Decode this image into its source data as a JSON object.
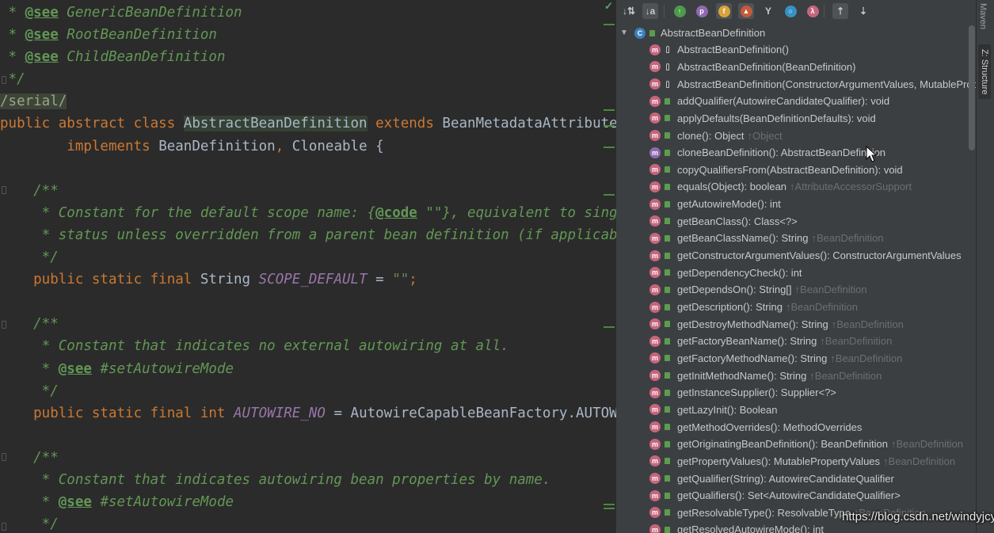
{
  "editor": {
    "lines": [
      [
        {
          "t": " * ",
          "c": "doc"
        },
        {
          "t": "@see",
          "c": "doctag"
        },
        {
          "t": " GenericBeanDefinition",
          "c": "doc"
        }
      ],
      [
        {
          "t": " * ",
          "c": "doc"
        },
        {
          "t": "@see",
          "c": "doctag"
        },
        {
          "t": " RootBeanDefinition",
          "c": "doc"
        }
      ],
      [
        {
          "t": " * ",
          "c": "doc"
        },
        {
          "t": "@see",
          "c": "doctag"
        },
        {
          "t": " ChildBeanDefinition",
          "c": "doc"
        }
      ],
      [
        {
          "t": " */",
          "c": "doc"
        }
      ],
      [
        {
          "t": "/serial/",
          "c": "serial"
        }
      ],
      [
        {
          "t": "public abstract class ",
          "c": "kw"
        },
        {
          "t": "AbstractBeanDefinition",
          "c": "hl"
        },
        {
          "t": " extends ",
          "c": "kw"
        },
        {
          "t": "BeanMetadataAttributeAccessor",
          "c": "plain"
        }
      ],
      [
        {
          "t": "        implements ",
          "c": "kw"
        },
        {
          "t": "BeanDefinition",
          "c": "plain"
        },
        {
          "t": ", ",
          "c": "kw"
        },
        {
          "t": "Cloneable {",
          "c": "plain"
        }
      ],
      [],
      [
        {
          "t": "    /**",
          "c": "doc"
        }
      ],
      [
        {
          "t": "     * Constant for the default scope name: ",
          "c": "doc"
        },
        {
          "t": "{",
          "c": "doc"
        },
        {
          "t": "@code",
          "c": "doctag"
        },
        {
          "t": " \"\"}, equivalent to singleton",
          "c": "doc"
        }
      ],
      [
        {
          "t": "     * status unless overridden from a parent bean definition (if applicable).",
          "c": "doc"
        }
      ],
      [
        {
          "t": "     */",
          "c": "doc"
        }
      ],
      [
        {
          "t": "    public static final ",
          "c": "kw"
        },
        {
          "t": "String ",
          "c": "plain"
        },
        {
          "t": "SCOPE_DEFAULT",
          "c": "const"
        },
        {
          "t": " = ",
          "c": "plain"
        },
        {
          "t": "\"\"",
          "c": "str"
        },
        {
          "t": ";",
          "c": "kw"
        }
      ],
      [],
      [
        {
          "t": "    /**",
          "c": "doc"
        }
      ],
      [
        {
          "t": "     * Constant that indicates no external autowiring at all.",
          "c": "doc"
        }
      ],
      [
        {
          "t": "     * ",
          "c": "doc"
        },
        {
          "t": "@see",
          "c": "doctag"
        },
        {
          "t": " #setAutowireMode",
          "c": "doc"
        }
      ],
      [
        {
          "t": "     */",
          "c": "doc"
        }
      ],
      [
        {
          "t": "    public static final int ",
          "c": "kw"
        },
        {
          "t": "AUTOWIRE_NO",
          "c": "const"
        },
        {
          "t": " = AutowireCapableBeanFactory.AUTOWIRE_NO;",
          "c": "plain"
        }
      ],
      [],
      [
        {
          "t": "    /**",
          "c": "doc"
        }
      ],
      [
        {
          "t": "     * Constant that indicates autowiring bean properties by name.",
          "c": "doc"
        }
      ],
      [
        {
          "t": "     * ",
          "c": "doc"
        },
        {
          "t": "@see",
          "c": "doctag"
        },
        {
          "t": " #setAutowireMode",
          "c": "doc"
        }
      ],
      [
        {
          "t": "     */",
          "c": "doc"
        }
      ]
    ]
  },
  "structure": {
    "toolbar": [
      {
        "icon": "sort-by-visibility-icon",
        "glyph": "↓⇅"
      },
      {
        "icon": "sort-alphabetically-icon",
        "glyph": "↓a"
      },
      {
        "icon": "show-inherited-icon",
        "glyph": "↑",
        "color": "#4e9a4b"
      },
      {
        "icon": "show-properties-icon",
        "glyph": "p",
        "color": "#8f6ab0"
      },
      {
        "icon": "show-fields-icon",
        "glyph": "f",
        "color": "#d9a33a"
      },
      {
        "icon": "show-non-public-icon",
        "glyph": "▲",
        "color": "#c45a3c"
      },
      {
        "icon": "show-lambdas-icon",
        "glyph": "Y"
      },
      {
        "icon": "show-anonymous-icon",
        "glyph": "○",
        "color": "#3592c4"
      },
      {
        "icon": "show-lambda-icon",
        "glyph": "λ",
        "color": "#c6657d"
      },
      {
        "icon": "autoscroll-to-source-icon",
        "glyph": "⇡"
      },
      {
        "icon": "autoscroll-from-source-icon",
        "glyph": "⇣"
      }
    ],
    "root": "AbstractBeanDefinition",
    "members": [
      {
        "name": "AbstractBeanDefinition()",
        "vis": "protected"
      },
      {
        "name": "AbstractBeanDefinition(BeanDefinition)",
        "vis": "protected"
      },
      {
        "name": "AbstractBeanDefinition(ConstructorArgumentValues, MutablePropertyValues)",
        "vis": "protected"
      },
      {
        "name": "addQualifier(AutowireCandidateQualifier): void",
        "vis": "public"
      },
      {
        "name": "applyDefaults(BeanDefinitionDefaults): void",
        "vis": "public"
      },
      {
        "name": "clone(): Object",
        "inh": "↑Object",
        "vis": "public"
      },
      {
        "name": "cloneBeanDefinition(): AbstractBeanDefinition",
        "vis": "public",
        "override": true
      },
      {
        "name": "copyQualifiersFrom(AbstractBeanDefinition): void",
        "vis": "public"
      },
      {
        "name": "equals(Object): boolean",
        "inh": "↑AttributeAccessorSupport",
        "vis": "public"
      },
      {
        "name": "getAutowireMode(): int",
        "vis": "public"
      },
      {
        "name": "getBeanClass(): Class<?>",
        "vis": "public"
      },
      {
        "name": "getBeanClassName(): String",
        "inh": "↑BeanDefinition",
        "vis": "public"
      },
      {
        "name": "getConstructorArgumentValues(): ConstructorArgumentValues",
        "vis": "public"
      },
      {
        "name": "getDependencyCheck(): int",
        "vis": "public"
      },
      {
        "name": "getDependsOn(): String[]",
        "inh": "↑BeanDefinition",
        "vis": "public"
      },
      {
        "name": "getDescription(): String",
        "inh": "↑BeanDefinition",
        "vis": "public"
      },
      {
        "name": "getDestroyMethodName(): String",
        "inh": "↑BeanDefinition",
        "vis": "public"
      },
      {
        "name": "getFactoryBeanName(): String",
        "inh": "↑BeanDefinition",
        "vis": "public"
      },
      {
        "name": "getFactoryMethodName(): String",
        "inh": "↑BeanDefinition",
        "vis": "public"
      },
      {
        "name": "getInitMethodName(): String",
        "inh": "↑BeanDefinition",
        "vis": "public"
      },
      {
        "name": "getInstanceSupplier(): Supplier<?>",
        "vis": "public"
      },
      {
        "name": "getLazyInit(): Boolean",
        "vis": "public"
      },
      {
        "name": "getMethodOverrides(): MethodOverrides",
        "vis": "public"
      },
      {
        "name": "getOriginatingBeanDefinition(): BeanDefinition",
        "inh": "↑BeanDefinition",
        "vis": "public"
      },
      {
        "name": "getPropertyValues(): MutablePropertyValues",
        "inh": "↑BeanDefinition",
        "vis": "public"
      },
      {
        "name": "getQualifier(String): AutowireCandidateQualifier",
        "vis": "public"
      },
      {
        "name": "getQualifiers(): Set<AutowireCandidateQualifier>",
        "vis": "public"
      },
      {
        "name": "getResolvableType(): ResolvableType",
        "inh": "↑BeanDefinition",
        "vis": "public"
      },
      {
        "name": "getResolvedAutowireMode(): int",
        "vis": "public"
      }
    ]
  },
  "side_tabs": {
    "maven": "Maven",
    "structure": "Z: Structure"
  },
  "watermark": "https://blog.csdn.net/windyjcy",
  "colors": {
    "method_badge": "#c6657d",
    "public": "#5a9e4b",
    "keyword": "#cc7832",
    "doc": "#629755"
  }
}
